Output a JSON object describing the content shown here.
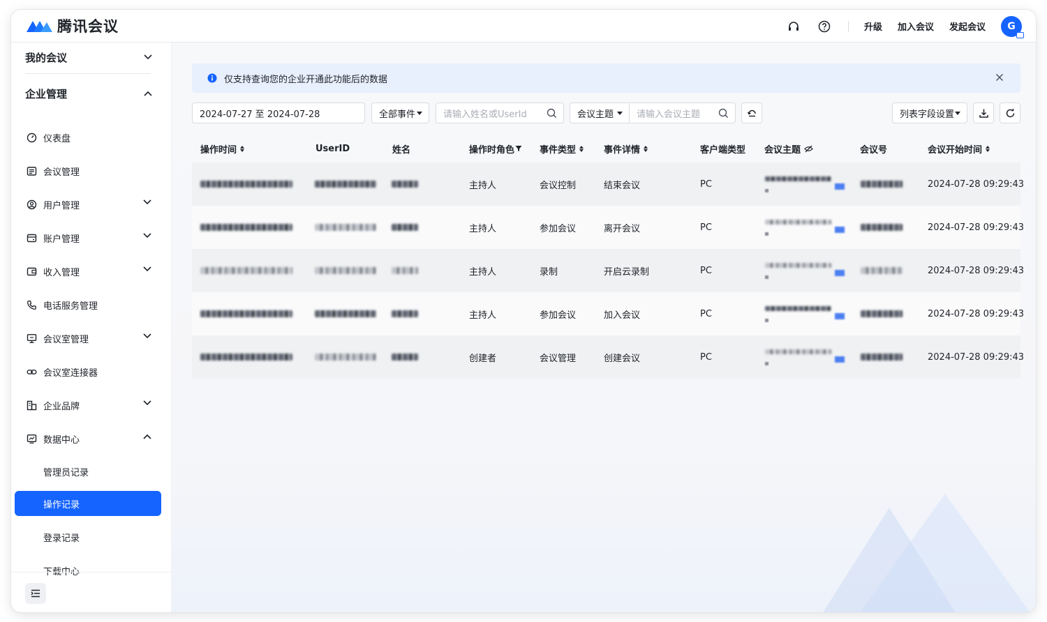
{
  "header": {
    "logo_text": "腾讯会议",
    "links": {
      "upgrade": "升级",
      "join": "加入会议",
      "start": "发起会议"
    },
    "avatar_letter": "G"
  },
  "sidebar": {
    "my_meetings": "我的会议",
    "enterprise": "企业管理",
    "items": [
      {
        "label": "仪表盘",
        "icon": "dashboard-icon"
      },
      {
        "label": "会议管理",
        "icon": "list-icon"
      },
      {
        "label": "用户管理",
        "icon": "user-icon"
      },
      {
        "label": "账户管理",
        "icon": "wallet-icon"
      },
      {
        "label": "收入管理",
        "icon": "income-icon"
      },
      {
        "label": "电话服务管理",
        "icon": "phone-icon"
      },
      {
        "label": "会议室管理",
        "icon": "room-icon"
      },
      {
        "label": "会议室连接器",
        "icon": "link-icon"
      },
      {
        "label": "企业品牌",
        "icon": "brand-icon"
      },
      {
        "label": "数据中心",
        "icon": "chart-icon"
      }
    ],
    "sub_items": [
      "管理员记录",
      "操作记录",
      "登录记录",
      "下载中心"
    ]
  },
  "notice": {
    "text": "仅支持查询您的企业开通此功能后的数据"
  },
  "filters": {
    "date_range": "2024-07-27 至 2024-07-28",
    "event_select": "全部事件",
    "name_placeholder": "请输入姓名或UserId",
    "topic_select": "会议主题",
    "topic_placeholder": "请输入会议主题",
    "column_settings": "列表字段设置"
  },
  "table": {
    "columns": [
      "操作时间",
      "UserID",
      "姓名",
      "操作时角色",
      "事件类型",
      "事件详情",
      "客户端类型",
      "会议主题",
      "会议号",
      "会议开始时间"
    ],
    "rows": [
      {
        "role": "主持人",
        "event_type": "会议控制",
        "event_detail": "结束会议",
        "client": "PC",
        "start": "2024-07-28 09:29:43"
      },
      {
        "role": "主持人",
        "event_type": "参加会议",
        "event_detail": "离开会议",
        "client": "PC",
        "start": "2024-07-28 09:29:43"
      },
      {
        "role": "主持人",
        "event_type": "录制",
        "event_detail": "开启云录制",
        "client": "PC",
        "start": "2024-07-28 09:29:43"
      },
      {
        "role": "主持人",
        "event_type": "参加会议",
        "event_detail": "加入会议",
        "client": "PC",
        "start": "2024-07-28 09:29:43"
      },
      {
        "role": "创建者",
        "event_type": "会议管理",
        "event_detail": "创建会议",
        "client": "PC",
        "start": "2024-07-28 09:29:43"
      }
    ]
  },
  "colors": {
    "accent": "#1664ff",
    "notice_bg": "#e8effd"
  }
}
